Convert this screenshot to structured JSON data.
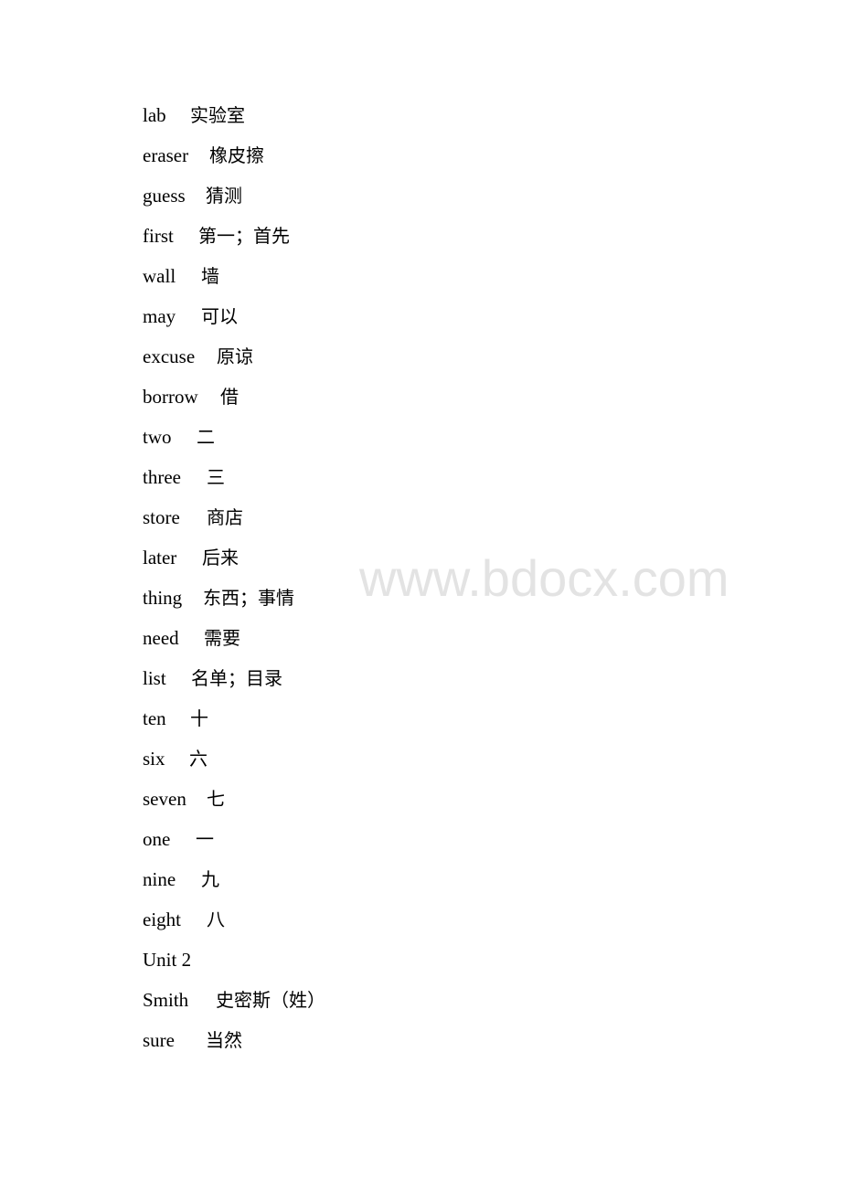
{
  "document": {
    "entries": [
      {
        "en": "lab",
        "zh": "实验室",
        "gap": 52
      },
      {
        "en": "eraser",
        "zh": "橡皮擦",
        "gap": 73
      },
      {
        "en": "guess",
        "zh": "猜测",
        "gap": 69
      },
      {
        "en": "first",
        "zh": "第一；首先",
        "gap": 61
      },
      {
        "en": "wall",
        "zh": "墙",
        "gap": 64
      },
      {
        "en": "may",
        "zh": "可以",
        "gap": 64
      },
      {
        "en": "excuse",
        "zh": "原谅",
        "gap": 81
      },
      {
        "en": "borrow",
        "zh": "借",
        "gap": 85
      },
      {
        "en": "two",
        "zh": "二",
        "gap": 59
      },
      {
        "en": "three",
        "zh": "三",
        "gap": 70
      },
      {
        "en": "store",
        "zh": "商店",
        "gap": 70
      },
      {
        "en": "later",
        "zh": "后来",
        "gap": 65
      },
      {
        "en": "thing",
        "zh": "东西；事情",
        "gap": 66
      },
      {
        "en": "need",
        "zh": "需要",
        "gap": 67
      },
      {
        "en": "list",
        "zh": "名单；目录",
        "gap": 53
      },
      {
        "en": "ten",
        "zh": "十",
        "gap": 52
      },
      {
        "en": "six",
        "zh": "六",
        "gap": 51
      },
      {
        "en": "seven",
        "zh": "七",
        "gap": 70
      },
      {
        "en": "one",
        "zh": "一",
        "gap": 58
      },
      {
        "en": "nine",
        "zh": "九",
        "gap": 64
      },
      {
        "en": "eight",
        "zh": "八",
        "gap": 70
      },
      {
        "en": "Unit 2",
        "zh": "",
        "gap": 0
      },
      {
        "en": "Smith",
        "zh": "史密斯（姓）",
        "gap": 80
      },
      {
        "en": "sure",
        "zh": "当然",
        "gap": 69
      }
    ]
  },
  "watermark": {
    "text": "www.bdocx.com"
  }
}
